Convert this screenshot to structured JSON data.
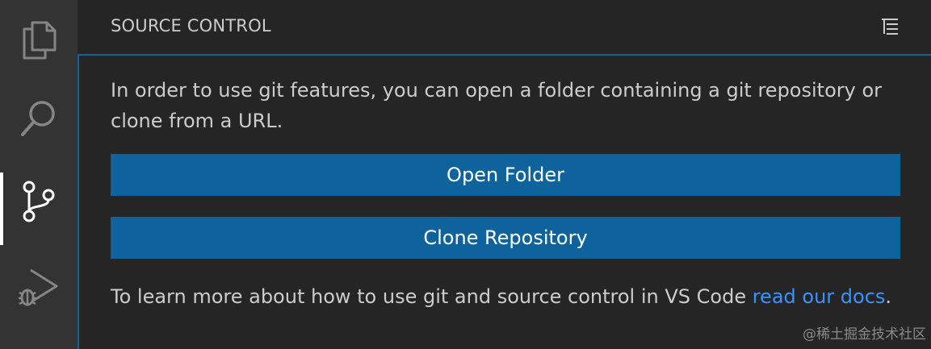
{
  "activity_bar": {
    "items": [
      {
        "icon": "files-icon",
        "active": false
      },
      {
        "icon": "search-icon",
        "active": false
      },
      {
        "icon": "source-control-icon",
        "active": true
      },
      {
        "icon": "run-debug-icon",
        "active": false
      }
    ]
  },
  "sidebar": {
    "title": "SOURCE CONTROL",
    "menu_icon": "views-menu-icon"
  },
  "source_control": {
    "intro_text": "In order to use git features, you can open a folder containing a git repository or clone from a URL.",
    "open_folder_label": "Open Folder",
    "clone_repository_label": "Clone Repository",
    "footer_prefix": "To learn more about how to use git and source control in VS Code ",
    "footer_link": "read our docs",
    "footer_suffix": "."
  },
  "watermark": "@稀土掘金技术社区",
  "colors": {
    "activity_bar_bg": "#333333",
    "sidebar_bg": "#252526",
    "button_bg": "#0e639c",
    "link": "#3794ff",
    "focus_border": "#0e639c"
  }
}
